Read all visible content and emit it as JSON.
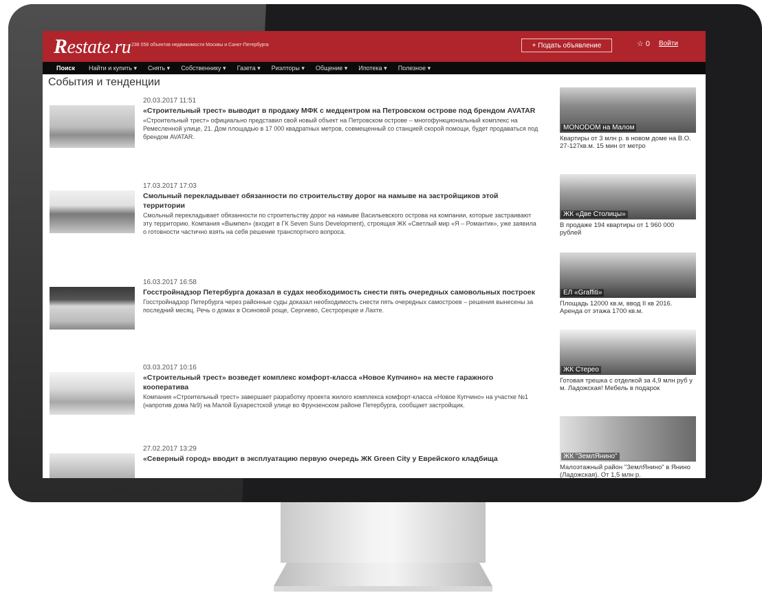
{
  "header": {
    "logo_r": "R",
    "logo_rest": "estate.ru",
    "tagline": "— 238 058 объектов недвижимости Москвы и Санкт-Петербурга",
    "post_button": "+ Подать объявление",
    "favorites_count": "☆ 0",
    "login": "Войти"
  },
  "nav": {
    "items": [
      {
        "label": "Поиск"
      },
      {
        "label": "Найти и купить ▾"
      },
      {
        "label": "Снять ▾"
      },
      {
        "label": "Собственнику ▾"
      },
      {
        "label": "Газета ▾"
      },
      {
        "label": "Риэлторы ▾"
      },
      {
        "label": "Общение ▾"
      },
      {
        "label": "Ипотека ▾"
      },
      {
        "label": "Полезное ▾"
      }
    ]
  },
  "page_title": "События и тенденции",
  "news": [
    {
      "date": "20.03.2017 11:51",
      "headline": "«Строительный трест» выводит в продажу МФК с медцентром на Петровском острове под брендом AVATAR",
      "summary": "«Строительный трест» официально представил свой новый объект на Петровском острове – многофункциональный комплекс на Ремесленной улице, 21. Дом площадью в 17 000 квадратных метров, совмещенный со станцией скорой помощи, будет продаваться под брендом AVATAR."
    },
    {
      "date": "17.03.2017 17:03",
      "headline": "Смольный перекладывает обязанности по строительству дорог на намыве на застройщиков этой территории",
      "summary": "Смольный перекладывает обязанности по строительству дорог на намыве Васильевского острова на компании, которые застраивают эту территорию. Компания «Вымпел» (входит в ГК Seven Suns Development), строящая ЖК «Светлый мир «Я – Романтик», уже заявила о готовности частично взять на себя решение транспортного вопроса."
    },
    {
      "date": "16.03.2017 16:58",
      "headline": "Госстройнадзор Петербурга доказал в судах необходимость снести пять очередных самовольных построек",
      "summary": "Госстройнадзор Петербурга через районные суды доказал необходимость снести пять очередных самостроев – решения вынесены за последний месяц. Речь о домах в Осиновой роще, Сергиево, Сестрорецке и Лахте."
    },
    {
      "date": "03.03.2017 10:16",
      "headline": "«Строительный трест» возведет комплекс комфорт-класса «Новое Купчино» на месте гаражного кооператива",
      "summary": "Компания «Строительный трест» завершает разработку проекта жилого комплекса комфорт-класса «Новое Купчино» на участке №1 (напротив дома №9) на Малой Бухарестской улице во Фрунзенском районе Петербурга, сообщает застройщик."
    },
    {
      "date": "27.02.2017 13:29",
      "headline": "«Северный город» вводит в эксплуатацию первую очередь ЖК Green City у Еврейского кладбища",
      "summary": ""
    }
  ],
  "sidebar": [
    {
      "caption": "MONODOM на Малом",
      "text": "Квартиры от 3 млн р. в новом доме на В.О. 27-127кв.м. 15 мин от метро"
    },
    {
      "caption": "ЖК «Две Столицы»",
      "text": "В продаже 194 квартиры от 1 960 000 рублей"
    },
    {
      "caption": "ЕЛ «Graffiti»",
      "text": "Площадь 12000 кв.м, ввод II кв 2016. Аренда от этажа 1700 кв.м."
    },
    {
      "caption": "ЖК Стерео",
      "text": "Готовая трешка с отделкой за 4,9 млн руб у м. Ладожская! Мебель в подарок"
    },
    {
      "caption": "ЖК \"ЗемлЯнино\"",
      "text": "Малоэтажный район \"ЗемлЯнино\" в Янино (Ладожская). От 1,5 млн р."
    }
  ],
  "colors": {
    "brand_red": "#b0242b",
    "nav_black": "#0b0b0b",
    "monitor_bezel": "#1c1c1e"
  }
}
